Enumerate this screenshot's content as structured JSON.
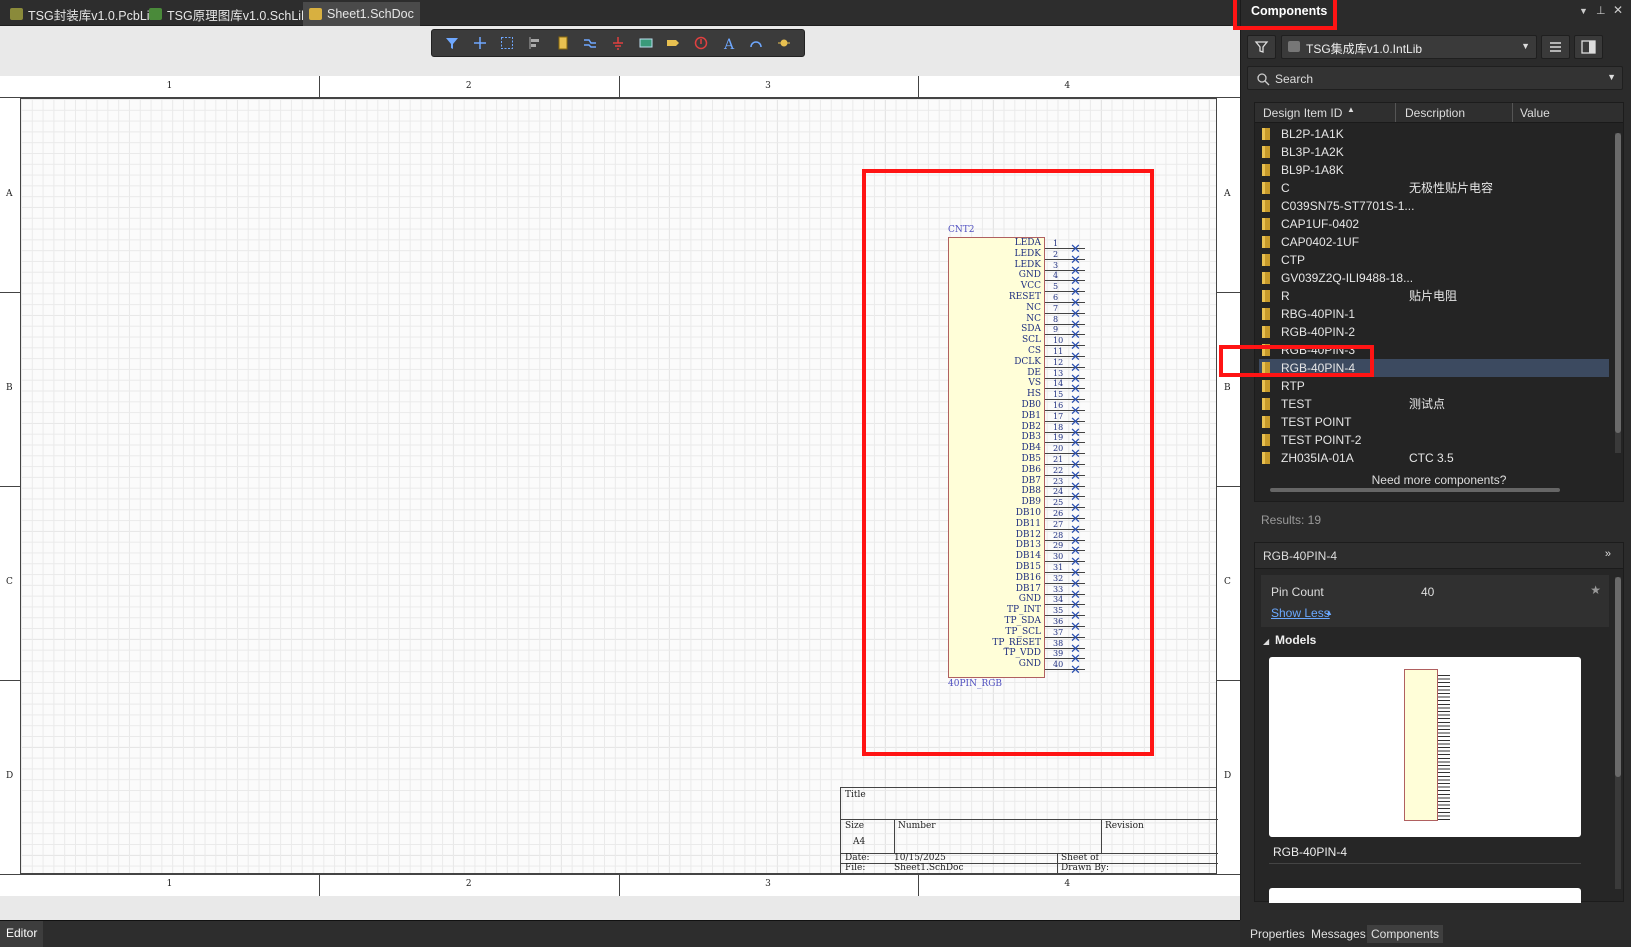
{
  "tabs": [
    {
      "label": "TSG封装库v1.0.PcbLib",
      "icon": "pcblib-icon"
    },
    {
      "label": "TSG原理图库v1.0.SchLib",
      "icon": "schlib-icon"
    },
    {
      "label": "Sheet1.SchDoc",
      "icon": "schdoc-icon"
    }
  ],
  "toolbar": {
    "icons": [
      "filter-icon",
      "cross-icon",
      "select-rect-icon",
      "align-icon",
      "part-icon",
      "wire-icon",
      "ground-icon",
      "port-icon",
      "net-label-icon",
      "no-erc-icon",
      "text-icon",
      "arc-icon",
      "junction-icon"
    ]
  },
  "sheet": {
    "zones_x": [
      "1",
      "2",
      "3",
      "4"
    ],
    "zones_y": [
      "A",
      "B",
      "C",
      "D"
    ]
  },
  "component": {
    "designator": "CNT2",
    "comment": "40PIN_RGB",
    "pins": [
      "LEDA",
      "LEDK",
      "LEDK",
      "GND",
      "VCC",
      "RESET",
      "NC",
      "NC",
      "SDA",
      "SCL",
      "CS",
      "DCLK",
      "DE",
      "VS",
      "HS",
      "DB0",
      "DB1",
      "DB2",
      "DB3",
      "DB4",
      "DB5",
      "DB6",
      "DB7",
      "DB8",
      "DB9",
      "DB10",
      "DB11",
      "DB12",
      "DB13",
      "DB14",
      "DB15",
      "DB16",
      "DB17",
      "GND",
      "TP_INT",
      "TP_SDA",
      "TP_SCL",
      "TP_RESET",
      "TP_VDD",
      "GND"
    ]
  },
  "titleblock": {
    "title": "Title",
    "size": "Size",
    "size_val": "A4",
    "number": "Number",
    "revision": "Revision",
    "date_lbl": "Date:",
    "date": "10/15/2025",
    "file_lbl": "File:",
    "file": "Sheet1.SchDoc",
    "sheet_lbl": "Sheet  of",
    "drawn": "Drawn By:"
  },
  "status": {
    "editor": "Editor"
  },
  "panel": {
    "title": "Components",
    "library": "TSG集成库v1.0.IntLib",
    "search_placeholder": "Search",
    "columns": [
      "Design Item ID",
      "Description",
      "Value"
    ],
    "items": [
      {
        "id": "BL2P-1A1K",
        "desc": ""
      },
      {
        "id": "BL3P-1A2K",
        "desc": ""
      },
      {
        "id": "BL9P-1A8K",
        "desc": ""
      },
      {
        "id": "C",
        "desc": "无极性贴片电容"
      },
      {
        "id": "C039SN75-ST7701S-1...",
        "desc": ""
      },
      {
        "id": "CAP1UF-0402",
        "desc": ""
      },
      {
        "id": "CAP0402-1UF",
        "desc": ""
      },
      {
        "id": "CTP",
        "desc": ""
      },
      {
        "id": "GV039Z2Q-ILI9488-18...",
        "desc": ""
      },
      {
        "id": "R",
        "desc": "贴片电阻"
      },
      {
        "id": "RBG-40PIN-1",
        "desc": ""
      },
      {
        "id": "RGB-40PIN-2",
        "desc": ""
      },
      {
        "id": "RGB-40PIN-3",
        "desc": ""
      },
      {
        "id": "RGB-40PIN-4",
        "desc": ""
      },
      {
        "id": "RTP",
        "desc": ""
      },
      {
        "id": "TEST",
        "desc": "测试点"
      },
      {
        "id": "TEST POINT",
        "desc": ""
      },
      {
        "id": "TEST POINT-2",
        "desc": ""
      },
      {
        "id": "ZH035IA-01A",
        "desc": "CTC 3.5"
      }
    ],
    "selected_index": 13,
    "need_more": "Need more components?",
    "results": "Results: 19",
    "detail": {
      "name": "RGB-40PIN-4",
      "pin_count_label": "Pin Count",
      "pin_count": "40",
      "show_less": "Show Less",
      "models_label": "Models",
      "model_name": "RGB-40PIN-4"
    },
    "bottom_tabs": [
      "Properties",
      "Messages",
      "Components"
    ]
  }
}
